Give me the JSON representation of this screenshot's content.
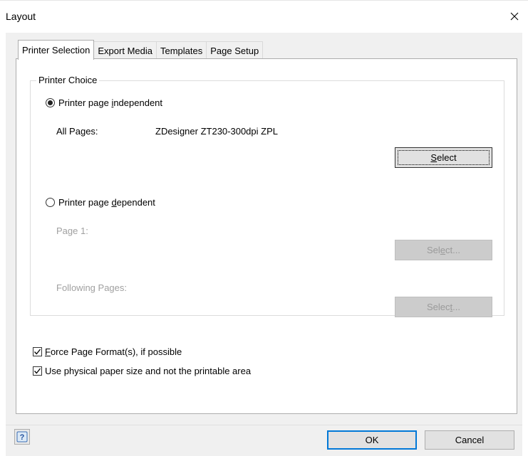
{
  "window": {
    "title": "Layout"
  },
  "tabs": [
    {
      "label": "Printer Selection",
      "active": true
    },
    {
      "label": "Export Media",
      "active": false
    },
    {
      "label": "Templates",
      "active": false
    },
    {
      "label": "Page Setup",
      "active": false
    }
  ],
  "printer_choice": {
    "group_label": "Printer Choice",
    "independent": {
      "label_before": "Printer page ",
      "mnemonic": "i",
      "label_after": "ndependent",
      "selected": true
    },
    "all_pages_label": "All Pages:",
    "all_pages_value": "ZDesigner ZT230-300dpi ZPL",
    "select_button": {
      "mnemonic": "S",
      "rest": "elect"
    },
    "dependent": {
      "label_before": "Printer page ",
      "mnemonic": "d",
      "label_after": "ependent",
      "selected": false
    },
    "page1_label": "Page 1:",
    "page1_button": {
      "before": "Sel",
      "mnemonic": "e",
      "after": "ct..."
    },
    "following_label": "Following Pages:",
    "following_button": {
      "before": "Selec",
      "mnemonic": "t",
      "after": "..."
    }
  },
  "options": {
    "force_format": {
      "mnemonic": "F",
      "rest": "orce Page Format(s), if possible",
      "checked": true
    },
    "physical_size": {
      "label": "Use physical paper size and not the printable area",
      "checked": true
    }
  },
  "footer": {
    "ok": "OK",
    "cancel": "Cancel"
  },
  "colors": {
    "accent": "#0078d7",
    "disabled_text": "#a0a0a0",
    "dialog_bg": "#f0f0f0"
  },
  "icons": {
    "close": "close-icon",
    "help": "help-icon",
    "check": "checkmark-icon"
  }
}
